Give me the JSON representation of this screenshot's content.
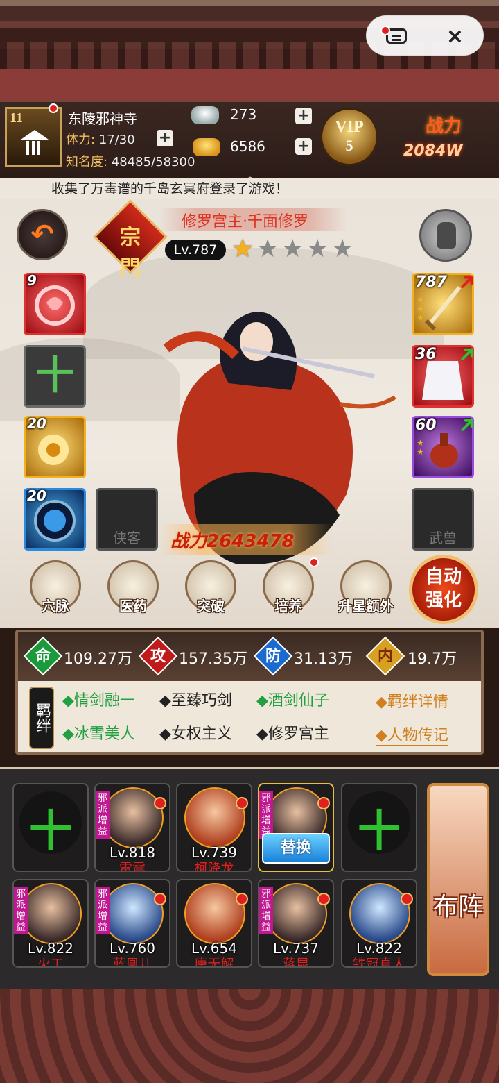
{
  "top_controls": {
    "menu_icon": "menu-icon",
    "close_icon": "×"
  },
  "player": {
    "level": "11",
    "name": "东陵邪神寺",
    "stamina_label": "体力:",
    "stamina_value": "17/30",
    "fame_label": "知名度:",
    "fame_value": "48485/58300",
    "silver": "273",
    "gold": "6586",
    "vip_label": "VIP",
    "vip_level": "5",
    "power_label": "战力",
    "power_value": "2084W"
  },
  "notice": "收集了万毒谱的千岛玄冥府登录了游戏！",
  "hero": {
    "sect": "宗門",
    "title": "修罗宫主·千面修罗",
    "level": "Lv.787",
    "stars_total": 5,
    "stars_filled": 1,
    "power": "战力2643478",
    "left_slots": [
      {
        "badge": "9",
        "icon": "heart-swirl-icon"
      },
      {
        "badge": "",
        "icon": "plus-icon",
        "text": "十"
      },
      {
        "badge": "20",
        "icon": "gold-flower-icon"
      },
      {
        "badge": "20",
        "icon": "blue-orb-icon"
      }
    ],
    "companion_label": "侠客",
    "beast_label": "武兽",
    "right_slots": [
      {
        "badge": "787",
        "icon": "sword-icon",
        "arrow": "red"
      },
      {
        "badge": "36",
        "icon": "white-robe-icon",
        "arrow": "green"
      },
      {
        "badge": "60",
        "icon": "teapot-icon",
        "arrow": "green"
      }
    ]
  },
  "menu": [
    {
      "label": "穴脉",
      "icon": "meridian-icon"
    },
    {
      "label": "医药",
      "icon": "herb-icon"
    },
    {
      "label": "突破",
      "icon": "breakthrough-icon"
    },
    {
      "label": "培养",
      "icon": "scroll-icon"
    },
    {
      "label": "升星额外",
      "icon": "star-up-icon"
    }
  ],
  "auto_button": {
    "line1": "自动",
    "line2": "强化"
  },
  "attributes": [
    {
      "icon": "命",
      "value": "109.27万",
      "color": "#1a9a3a"
    },
    {
      "icon": "攻",
      "value": "157.35万",
      "color": "#c01a1a"
    },
    {
      "icon": "防",
      "value": "31.13万",
      "color": "#1a6ad0"
    },
    {
      "icon": "内",
      "value": "19.7万",
      "color": "#d8a020"
    }
  ],
  "bonds": {
    "tag": "羁绊",
    "row1": [
      "◆情剑融一",
      "◆至臻巧剑",
      "◆酒剑仙子"
    ],
    "row2": [
      "◆冰雪美人",
      "◆女权主义",
      "◆修罗宫主"
    ],
    "link1": "◆羁绊详情",
    "link2": "◆人物传记"
  },
  "lineup": {
    "empty_plus": "十",
    "tag_text": "邪派增益",
    "replace": "替换",
    "formation": "布阵",
    "row1": [
      {
        "empty": true
      },
      {
        "level": "Lv.818",
        "name": "雷震"
      },
      {
        "level": "Lv.739",
        "name": "柯降龙"
      },
      {
        "selected": true
      },
      {
        "empty": true
      }
    ],
    "row2": [
      {
        "level": "Lv.822",
        "name": "火工"
      },
      {
        "level": "Lv.760",
        "name": "蓝凰儿"
      },
      {
        "level": "Lv.654",
        "name": "唐无解"
      },
      {
        "level": "Lv.737",
        "name": "蒋昆"
      },
      {
        "level": "Lv.822",
        "name": "铁冠真人"
      }
    ]
  }
}
